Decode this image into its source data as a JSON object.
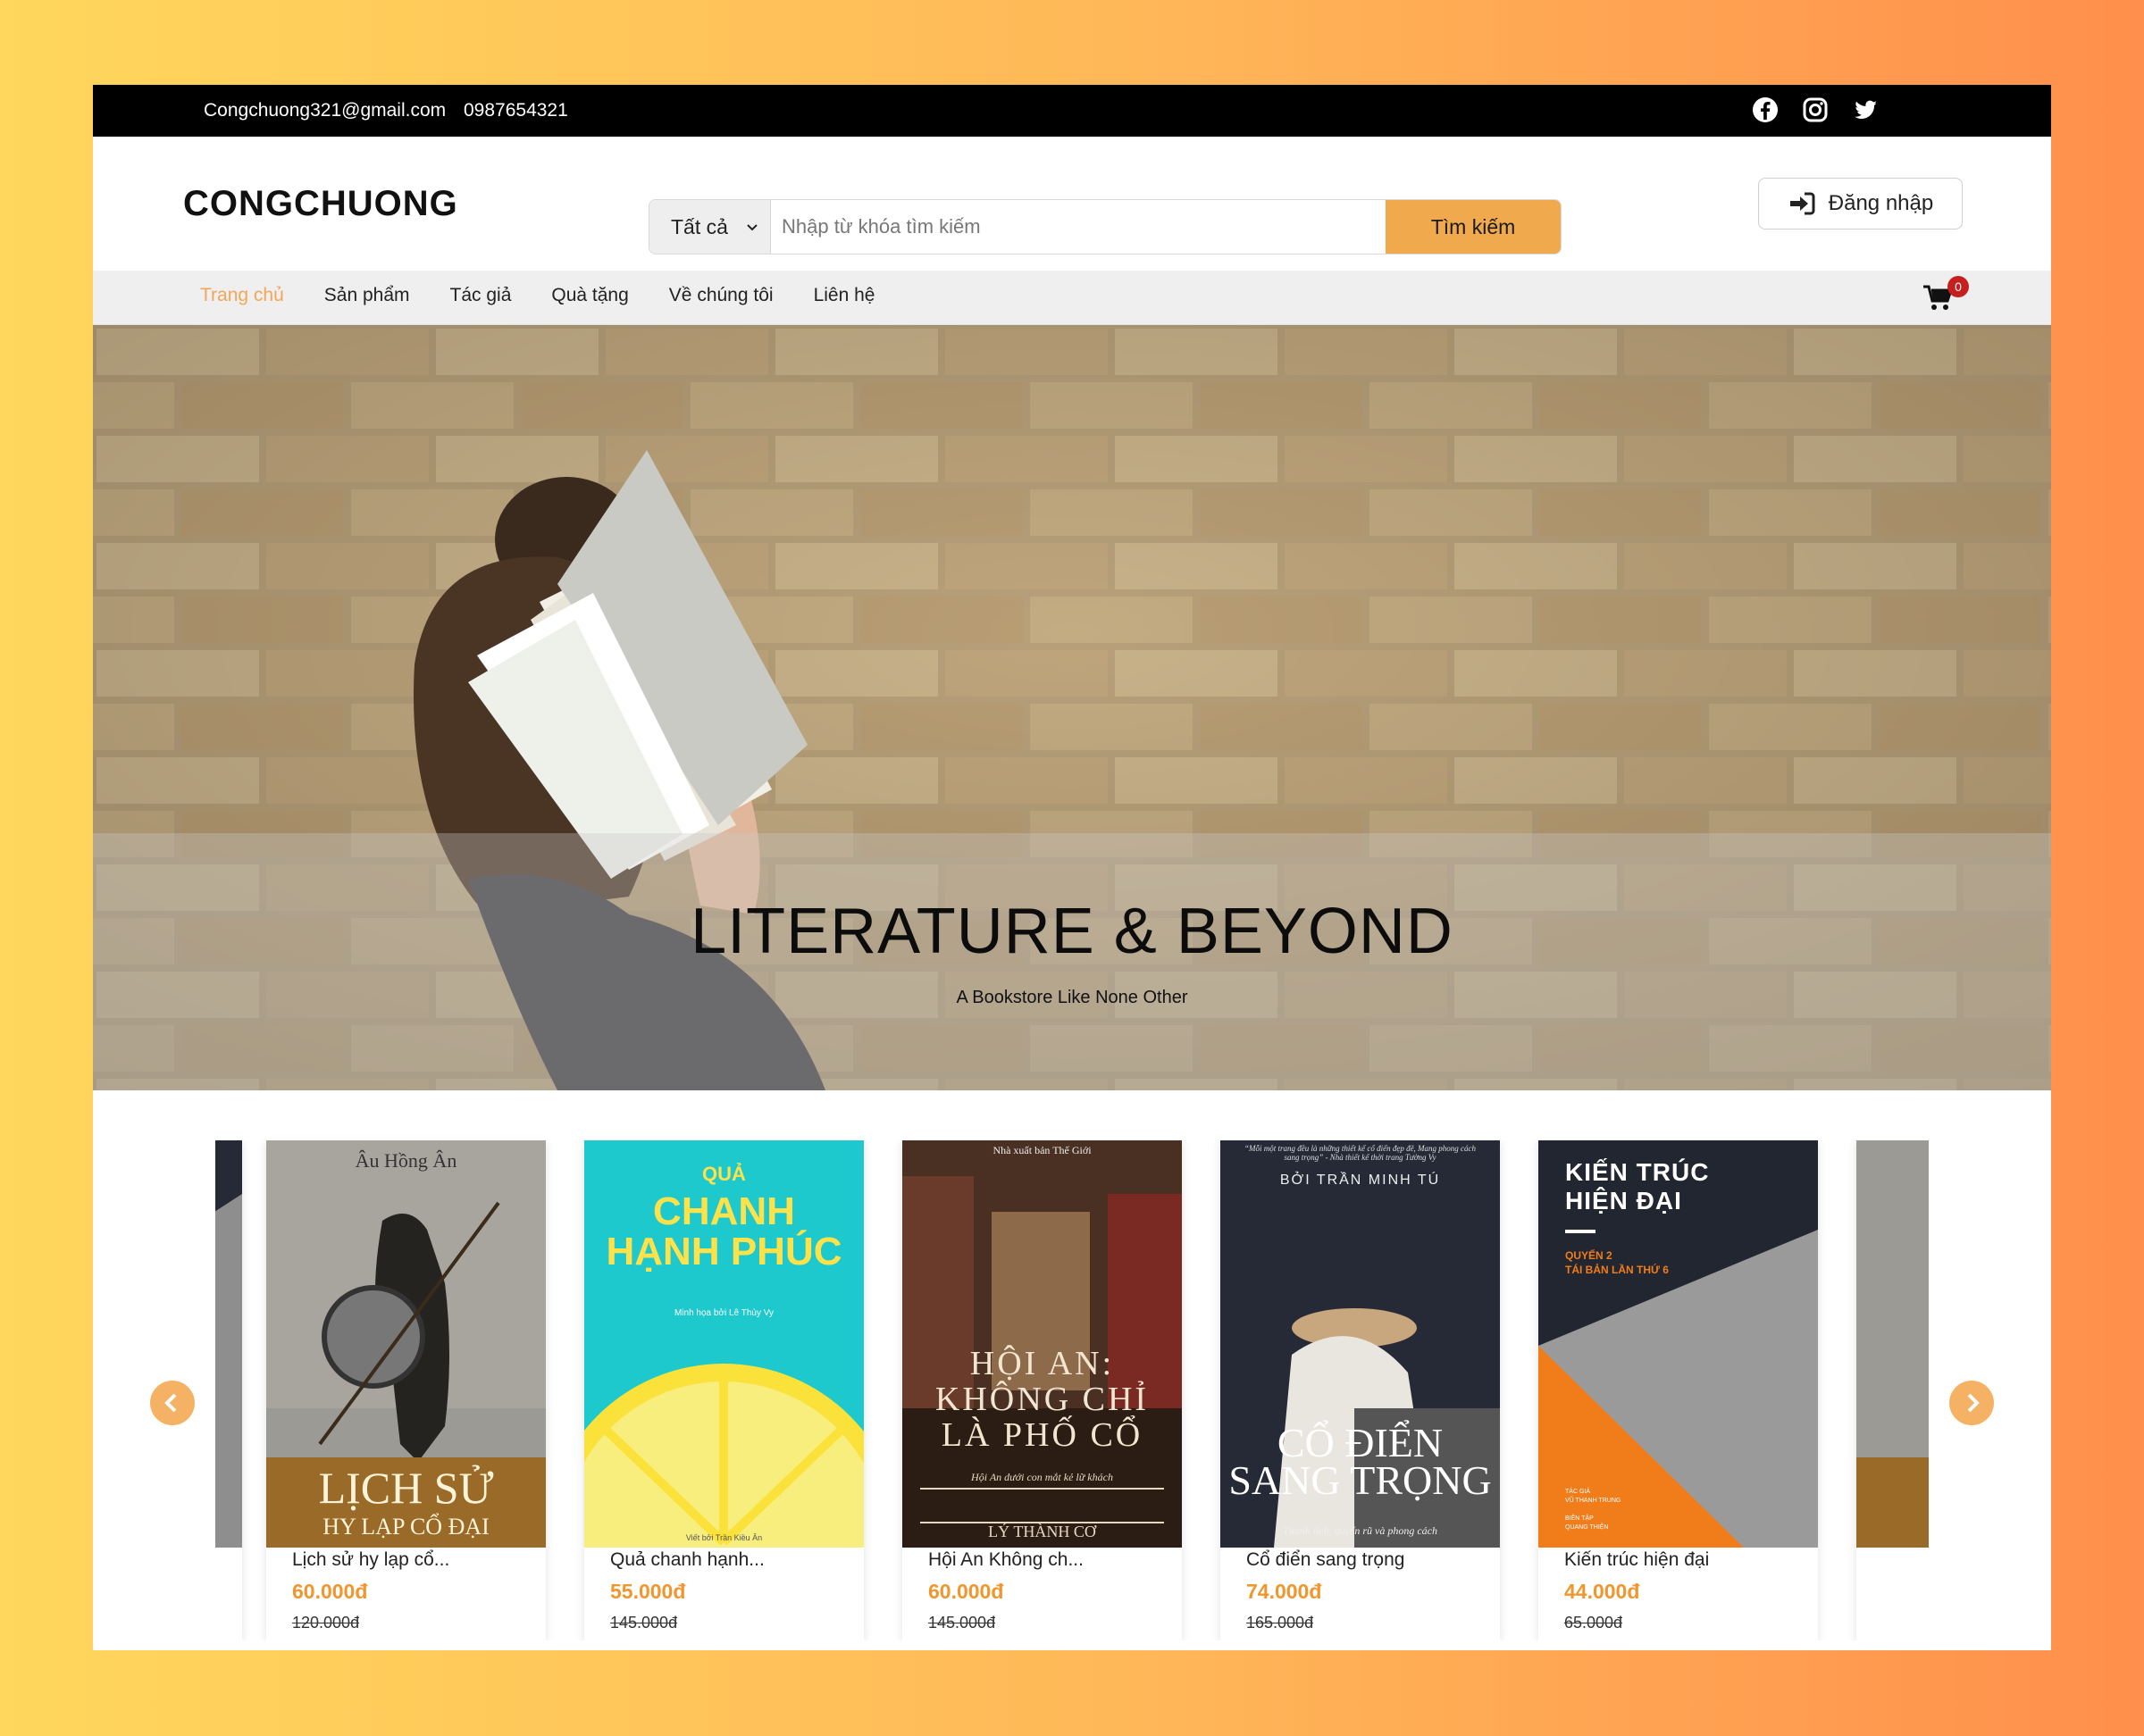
{
  "topbar": {
    "email": "Congchuong321@gmail.com",
    "phone": "0987654321",
    "social": [
      "facebook-icon",
      "instagram-icon",
      "twitter-icon"
    ]
  },
  "header": {
    "logo": "CONGCHUONG",
    "search": {
      "category": "Tất cả",
      "placeholder": "Nhập từ khóa tìm kiếm",
      "button": "Tìm kiếm"
    },
    "login": "Đăng nhập"
  },
  "nav": {
    "items": [
      "Trang chủ",
      "Sản phẩm",
      "Tác giả",
      "Quà tặng",
      "Về chúng tôi",
      "Liên hệ"
    ],
    "active_index": 0,
    "cart_count": "0"
  },
  "hero": {
    "title": "LITERATURE & BEYOND",
    "subtitle": "A Bookstore Like None Other"
  },
  "products": [
    {
      "cover": {
        "author": "Âu Hồng Ân",
        "title1": "LỊCH SỬ",
        "title2": "HY LẠP CỔ ĐẠI"
      },
      "title": "Lịch sử hy lạp cổ...",
      "price": "60.000đ",
      "old_price": "120.000đ"
    },
    {
      "cover": {
        "title1": "QUẢ",
        "title2": "CHANH",
        "title3": "HẠNH PHÚC",
        "credit": "Minh họa bởi Lê Thùy Vy",
        "bottom": "Viết bởi Trần Kiều Ân"
      },
      "title": "Quả chanh hạnh...",
      "price": "55.000đ",
      "old_price": "145.000đ"
    },
    {
      "cover": {
        "publisher": "Nhà xuất bản Thế Giới",
        "title1": "HỘI AN:",
        "title2": "KHÔNG CHỈ",
        "title3": "LÀ PHỐ CỔ",
        "tagline": "Hội An dưới con mắt kẻ lữ khách",
        "author": "LÝ THÀNH CƠ"
      },
      "title": "Hội An Không ch...",
      "price": "60.000đ",
      "old_price": "145.000đ"
    },
    {
      "cover": {
        "quote": "“Mỗi một trang đều là những thiết kế cổ điển đẹp đẽ, Mang phong cách sang trọng” - Nhà thiết kế thời trang Tường Vy",
        "author": "BỞI TRẦN MINH TÚ",
        "title1": "CỔ ĐIỂN",
        "title2": "SANG TRỌNG",
        "tagline": "Thanh lịch, quyến rũ và phong cách"
      },
      "title": "Cổ điển sang trọng",
      "price": "74.000đ",
      "old_price": "165.000đ"
    },
    {
      "cover": {
        "title1": "KIẾN TRÚC",
        "title2": "HIỆN ĐẠI",
        "volume": "QUYỂN 2",
        "edition": "TÁI BẢN LẦN THỨ 6",
        "author_label": "TÁC GIẢ",
        "author": "VŨ THANH TRUNG",
        "editor_label": "BIÊN TẬP",
        "editor": "QUANG THIỆN"
      },
      "title": "Kiến trúc hiện đại",
      "price": "44.000đ",
      "old_price": "65.000đ"
    }
  ],
  "colors": {
    "accent": "#f0a94d",
    "price": "#f0962e",
    "active_nav": "#f2a65a",
    "topbar": "#000000"
  }
}
